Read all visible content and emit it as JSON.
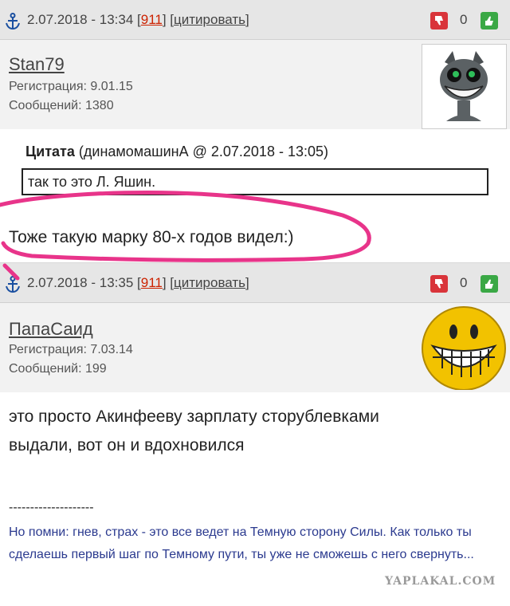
{
  "posts": [
    {
      "date": "2.07.2018 - 13:34",
      "bracket_open": "[",
      "post_number": "911",
      "bracket_mid": "] [",
      "quote_label": "цитировать",
      "bracket_close": "]",
      "votes": "0",
      "username": "Stan79",
      "registration": "Регистрация: 9.01.15",
      "messages": "Сообщений: 1380",
      "avatar": "grinning-cat-avatar",
      "quote": {
        "label": "Цитата",
        "source": "(динамомашинА @ 2.07.2018 - 13:05)",
        "text": "так то это Л. Яшин."
      },
      "text": "Тоже такую марку 80-х годов видел:)"
    },
    {
      "date": "2.07.2018 - 13:35",
      "bracket_open": "[",
      "post_number": "911",
      "bracket_mid": "] [",
      "quote_label": "цитировать",
      "bracket_close": "]",
      "votes": "0",
      "username": "ПапаСаид",
      "registration": "Регистрация: 7.03.14",
      "messages": "Сообщений: 199",
      "avatar": "grinning-smiley-avatar",
      "text_line1": "это просто Акинфееву зарплату сторублевками",
      "text_line2": "выдали, вот он и вдохновился",
      "signature_separator": "--------------------",
      "signature": "Но помни: гнев, страх - это все ведет на Темную сторону Силы. Как только ты сделаешь первый шаг по Темному пути, ты уже не сможешь с него свернуть..."
    }
  ],
  "watermark": "YAPLAKAL.COM",
  "colors": {
    "header_bg": "#e6e6e6",
    "user_bg": "#f2f2f2",
    "post_number": "#cc2200",
    "signature": "#2b3a8f",
    "highlight_circle": "#e8348a",
    "vote_down": "#d9343a",
    "vote_up": "#3aa845"
  }
}
